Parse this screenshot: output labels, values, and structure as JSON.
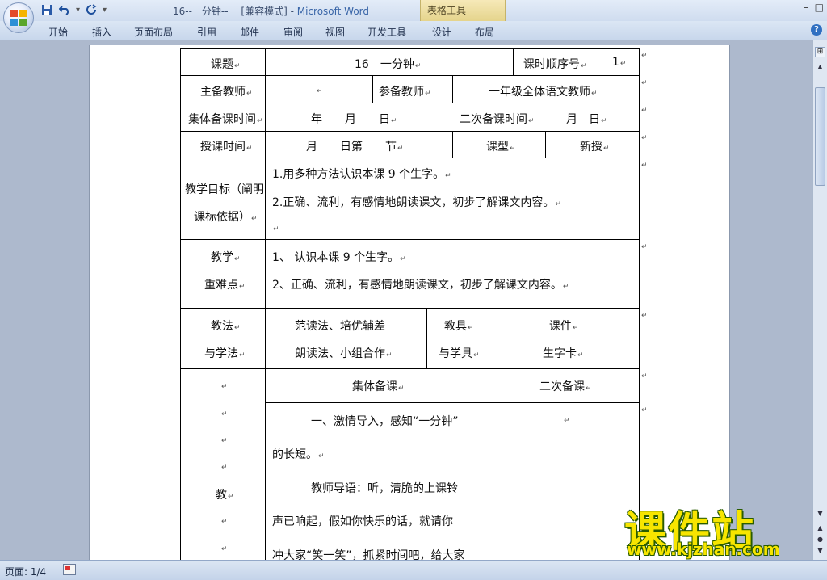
{
  "window": {
    "title": "16--一分钟--一 [兼容模式]  -  ",
    "app_name": "Microsoft Word",
    "context_group": "表格工具",
    "controls": [
      "–",
      "□"
    ]
  },
  "ribbon_tabs": [
    "开始",
    "插入",
    "页面布局",
    "引用",
    "邮件",
    "审阅",
    "视图",
    "开发工具",
    "设计",
    "布局"
  ],
  "quick_access": {
    "save": "save-icon",
    "undo": "undo-icon",
    "redo": "redo-icon",
    "customize": "▾"
  },
  "status": {
    "page": "页面: 1/4"
  },
  "watermark": {
    "title": "课件站",
    "url": "www.kjzhan.com"
  },
  "table": {
    "r1": {
      "topic_label": "课题",
      "topic_value": "16　一分钟",
      "order_label": "课时顺序号",
      "order_value": "1"
    },
    "r2": {
      "main_teacher_label": "主备教师",
      "main_teacher_value": "",
      "assist_teacher_label": "参备教师",
      "assist_teacher_value": "一年级全体语文教师"
    },
    "r3": {
      "group_time_label": "集体备课时间",
      "group_time_value": "年　　月　　日",
      "second_time_label": "二次备课时间",
      "second_time_value": "月　日"
    },
    "r4": {
      "teach_time_label": "授课时间",
      "teach_time_value": "月　　日第　　节",
      "type_label": "课型",
      "type_value": "新授"
    },
    "goals": {
      "label_1": "教学目标（阐明",
      "label_2": "课标依据）",
      "line_1": "1.用多种方法认识本课 9 个生字。",
      "line_2": "2.正确、流利，有感情地朗读课文，初步了解课文内容。"
    },
    "keypoints": {
      "label_1": "教学",
      "label_2": "重难点",
      "line_1": "1、 认识本课 9 个生字。",
      "line_2": "2、正确、流利，有感情地朗读课文，初步了解课文内容。"
    },
    "methods": {
      "label_1": "教法",
      "label_2": "与学法",
      "value_1": "范读法、培优辅差",
      "value_2": "朗读法、小组合作",
      "tools_label_1": "教具",
      "tools_label_2": "与学具",
      "tools_value_1": "课件",
      "tools_value_2": "生字卡"
    },
    "process": {
      "left_char": "教",
      "group_label": "集体备课",
      "second_label": "二次备课",
      "lines": [
        "一、激情导入，感知“一分钟”",
        "的长短。",
        "教师导语：听，清脆的上课铃",
        "声已响起，假如你快乐的话，就请你",
        "冲大家“笑一笑”，抓紧时间吧，给大家"
      ]
    }
  }
}
